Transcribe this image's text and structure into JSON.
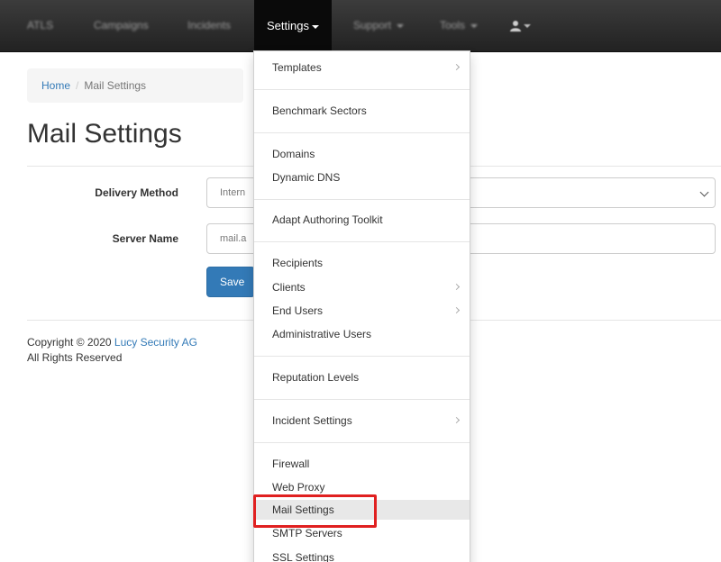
{
  "nav": {
    "items": [
      {
        "label": "ATLS"
      },
      {
        "label": "Campaigns"
      },
      {
        "label": "Incidents"
      },
      {
        "label": "Settings"
      },
      {
        "label": "Support"
      },
      {
        "label": "Tools"
      }
    ]
  },
  "breadcrumb": {
    "home": "Home",
    "separator": "/",
    "current": "Mail Settings"
  },
  "page": {
    "title": "Mail Settings"
  },
  "form": {
    "delivery_method_label": "Delivery Method",
    "delivery_method_value": "Intern",
    "server_name_label": "Server Name",
    "server_name_value": "mail.a",
    "save_label": "Save"
  },
  "footer": {
    "copyright": "Copyright © 2020",
    "company": "Lucy Security AG",
    "rights": "All Rights Reserved"
  },
  "dropdown": {
    "items": [
      {
        "label": "Templates",
        "submenu": true
      },
      {
        "label": "Benchmark Sectors",
        "submenu": false
      },
      {
        "label": "Domains",
        "submenu": false
      },
      {
        "label": "Dynamic DNS",
        "submenu": false
      },
      {
        "label": "Adapt Authoring Toolkit",
        "submenu": false
      },
      {
        "label": "Recipients",
        "submenu": false
      },
      {
        "label": "Clients",
        "submenu": true
      },
      {
        "label": "End Users",
        "submenu": true
      },
      {
        "label": "Administrative Users",
        "submenu": false
      },
      {
        "label": "Reputation Levels",
        "submenu": false
      },
      {
        "label": "Incident Settings",
        "submenu": true
      },
      {
        "label": "Firewall",
        "submenu": false
      },
      {
        "label": "Web Proxy",
        "submenu": false
      },
      {
        "label": "Mail Settings",
        "submenu": false,
        "highlighted": true
      },
      {
        "label": "SMTP Servers",
        "submenu": false
      },
      {
        "label": "SSL Settings",
        "submenu": false
      }
    ]
  },
  "colors": {
    "navbar": "#222222",
    "link": "#337ab7",
    "primary_button": "#337ab7",
    "highlight_box": "#e02020"
  }
}
